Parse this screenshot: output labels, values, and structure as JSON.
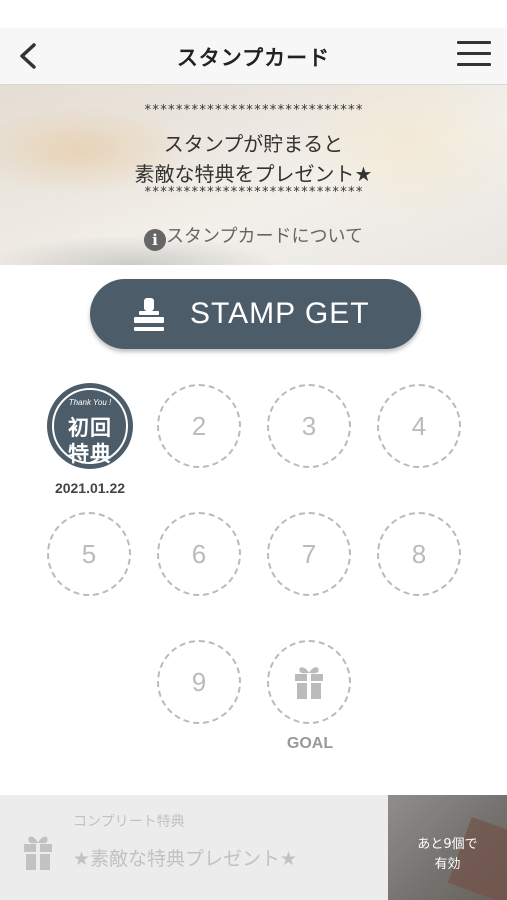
{
  "nav": {
    "title": "スタンプカード"
  },
  "banner": {
    "stars_top": "****************************",
    "line1": "スタンプが貯まると",
    "line2": "素敵な特典をプレゼント★",
    "stars_bottom": "****************************",
    "info_label": "スタンプカードについて",
    "info_icon": "i"
  },
  "stamp_button": {
    "label": "STAMP GET",
    "icon": "stamp-icon",
    "color": "#4c5c69"
  },
  "card": {
    "stamps": [
      {
        "thank_you": "Thank You !",
        "line1": "初回",
        "line2": "特典",
        "date": "2021.01.22"
      }
    ],
    "slots": [
      "2",
      "3",
      "4",
      "5",
      "6",
      "7",
      "8",
      "9"
    ],
    "goal_icon": "gift-icon",
    "goal_label": "GOAL"
  },
  "footer": {
    "label": "コンプリート特典",
    "title": "★素敵な特典プレゼント★",
    "remaining_line1": "あと9個で",
    "remaining_line2": "有効",
    "icon": "gift-icon"
  }
}
